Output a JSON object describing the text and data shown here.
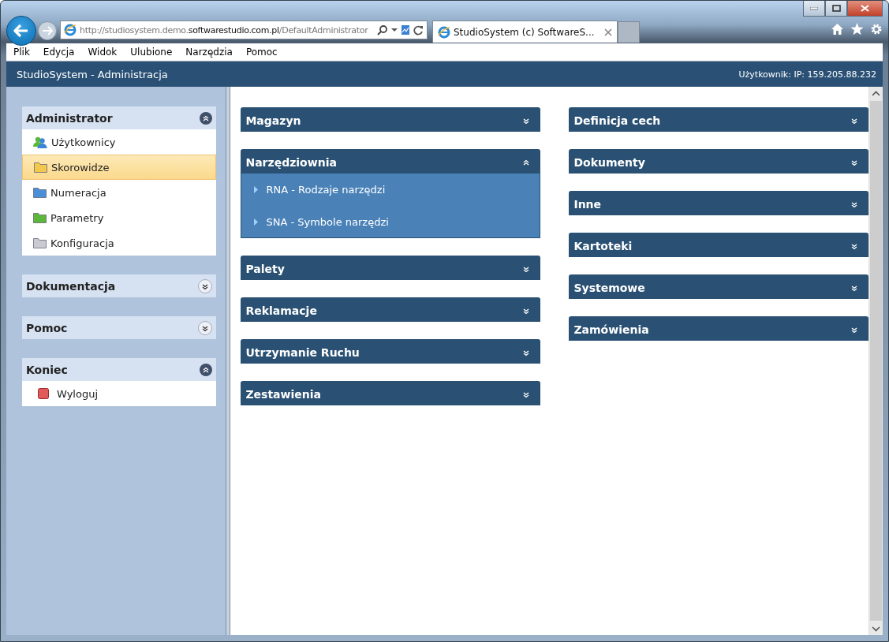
{
  "browser": {
    "address": "http://studiosystem.demo.**softwarestudio.com.pl**/DefaultAdministrator",
    "tabs": [
      {
        "title": "StudioSystem (c) SoftwareS...",
        "selected": true
      }
    ],
    "menu": [
      "Plik",
      "Edycja",
      "Widok",
      "Ulubione",
      "Narzędzia",
      "Pomoc"
    ]
  },
  "app": {
    "title": "StudioSystem - Administracja",
    "user": "Użytkownik: IP: 159.205.88.232"
  },
  "sidebar": {
    "groups": [
      {
        "title": "Administrator",
        "expanded": true,
        "items": [
          {
            "label": "Użytkownicy",
            "kind": "users",
            "selected": false
          },
          {
            "label": "Skorowidze",
            "kind": "folder",
            "color": "#f2c94c",
            "selected": true
          },
          {
            "label": "Numeracja",
            "kind": "folder",
            "color": "#4a90d9",
            "selected": false
          },
          {
            "label": "Parametry",
            "kind": "folder",
            "color": "#5cb83a",
            "selected": false
          },
          {
            "label": "Konfiguracja",
            "kind": "folder",
            "color": "#c8ccd2",
            "selected": false
          }
        ]
      },
      {
        "title": "Dokumentacja",
        "expanded": false
      },
      {
        "title": "Pomoc",
        "expanded": false
      },
      {
        "title": "Koniec",
        "expanded": true,
        "items": [
          {
            "label": "Wyloguj",
            "kind": "logout",
            "selected": false
          }
        ]
      }
    ]
  },
  "panels": {
    "left": [
      {
        "title": "Magazyn",
        "expanded": false
      },
      {
        "title": "Narzędziownia",
        "expanded": true,
        "items": [
          "RNA - Rodzaje narzędzi",
          "SNA - Symbole narzędzi"
        ]
      },
      {
        "title": "Palety",
        "expanded": false
      },
      {
        "title": "Reklamacje",
        "expanded": false
      },
      {
        "title": "Utrzymanie Ruchu",
        "expanded": false
      },
      {
        "title": "Zestawienia",
        "expanded": false
      }
    ],
    "right": [
      {
        "title": "Definicja cech",
        "expanded": false
      },
      {
        "title": "Dokumenty",
        "expanded": false
      },
      {
        "title": "Inne",
        "expanded": false
      },
      {
        "title": "Kartoteki",
        "expanded": false
      },
      {
        "title": "Systemowe",
        "expanded": false
      },
      {
        "title": "Zamówienia",
        "expanded": false
      }
    ]
  }
}
